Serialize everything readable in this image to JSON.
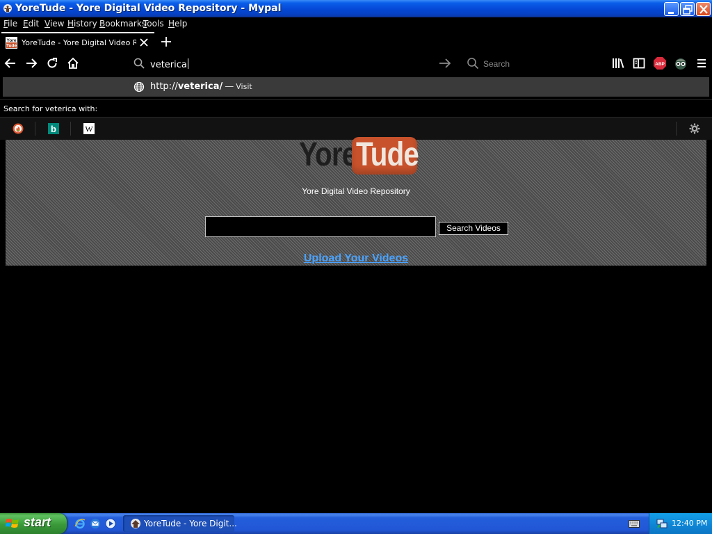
{
  "window": {
    "title": "YoreTude - Yore Digital Video Repository - Mypal"
  },
  "menu": [
    "File",
    "Edit",
    "View",
    "History",
    "Bookmarks",
    "Tools",
    "Help"
  ],
  "tab": {
    "title": "YoreTude - Yore Digital Video Repository",
    "favicon_text": [
      "Yore",
      "Tude"
    ]
  },
  "toolbar": {
    "url_text": "veterica",
    "search_placeholder": "Search",
    "adblock_badge": "ABP"
  },
  "dropdown": {
    "url_prefix": "http://",
    "url_bold": "veterica/",
    "separator": "—",
    "action": "Visit",
    "search_for": "Search for veterica with:",
    "engines": [
      "duckduckgo-icon",
      "bing-icon",
      "wikipedia-icon"
    ],
    "wikipedia_glyph": "W",
    "bing_glyph": "b"
  },
  "page": {
    "logo_left": "Yore",
    "logo_right": "Tude",
    "subtitle": "Yore Digital Video Repository",
    "search_value": "",
    "search_button": "Search Videos",
    "upload_link": "Upload Your Videos"
  },
  "taskbar": {
    "start_label": "start",
    "task_item": "YoreTude - Yore Digit...",
    "clock": "12:40 PM"
  },
  "colors": {
    "title_bar": "#0548d6",
    "logo_tube_bg": "#c8522c",
    "link": "#4aa3ff",
    "taskbar": "#245edb",
    "start_button": "#3a9a3a"
  }
}
